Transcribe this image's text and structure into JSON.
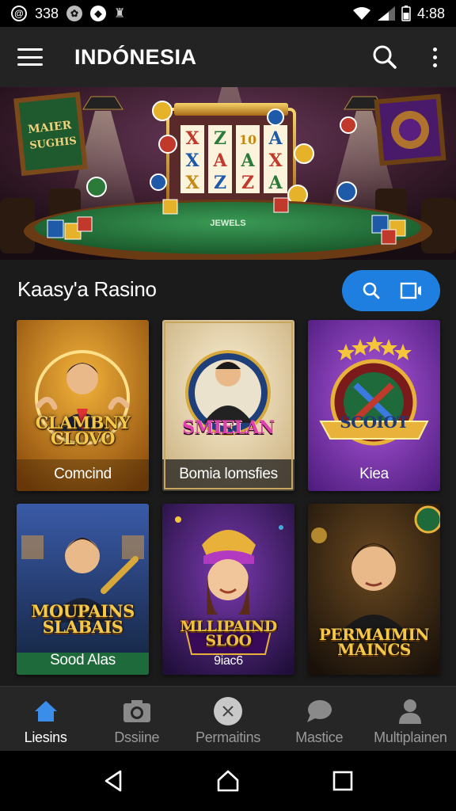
{
  "status_bar": {
    "notification_text": "338",
    "time": "4:88",
    "icons": [
      "at-sign-icon",
      "settings-gear-icon",
      "play-circle-icon",
      "android-icon",
      "wifi-icon",
      "signal-icon",
      "battery-icon"
    ]
  },
  "app_bar": {
    "title": "INDÓNESIA",
    "icons": [
      "menu-icon",
      "search-icon",
      "more-vert-icon"
    ]
  },
  "banner": {
    "slot_symbols": [
      "X",
      "Z",
      "10",
      "A",
      "X",
      "A",
      "A",
      "X",
      "X",
      "Z",
      "Z",
      "A"
    ],
    "left_board_text": [
      "MAIER",
      "SUGHIS"
    ],
    "table_text": "JEWELS"
  },
  "section": {
    "title": "Kaasy'a Rasino",
    "actions": [
      "search-icon",
      "screen-cast-icon"
    ]
  },
  "games": [
    {
      "logo": "CLAMBNY CLOVO",
      "label": "Comcind",
      "theme": "gold"
    },
    {
      "logo": "SMIELAN",
      "label": "Bomia lomsfies",
      "theme": "cream"
    },
    {
      "logo": "SCOIOT",
      "label": "Kiea",
      "theme": "purple"
    },
    {
      "logo": "MOUPAINS SLABAIS",
      "label": "Sood Alas",
      "theme": "blue"
    },
    {
      "logo": "MLLIPAIND SLOO",
      "label": "9iac6",
      "theme": "violet"
    },
    {
      "logo": "PERMAIMIN MAINCS",
      "label": "",
      "theme": "dark"
    }
  ],
  "bottom_nav": [
    {
      "label": "Liesins",
      "icon": "home-icon",
      "active": true
    },
    {
      "label": "Dssiine",
      "icon": "camera-icon",
      "active": false
    },
    {
      "label": "Permaitins",
      "icon": "close-circle-icon",
      "active": false
    },
    {
      "label": "Mastice",
      "icon": "chat-bubble-icon",
      "active": false
    },
    {
      "label": "Multiplainen",
      "icon": "person-icon",
      "active": false
    }
  ],
  "colors": {
    "accent": "#1e7fe0",
    "app_bar": "#232323",
    "background": "#1b1b1b",
    "nav_active_icon": "#3a8de8"
  }
}
